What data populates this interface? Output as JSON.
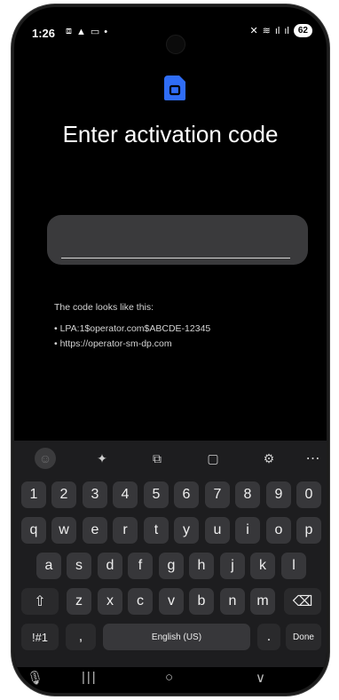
{
  "status_bar": {
    "time": "1:26",
    "left_icons": [
      "screenshot-icon",
      "warning-icon",
      "cast-icon",
      "dot-icon"
    ],
    "right_icons": [
      "mute-icon",
      "wifi-icon",
      "signal-icon",
      "signal-icon"
    ],
    "battery": "62"
  },
  "header": {
    "icon": "sim-card-icon",
    "title": "Enter activation code",
    "accent_color": "#2f6df6"
  },
  "code_input": {
    "value": "",
    "placeholder": ""
  },
  "hint": {
    "heading": "The code looks like this:",
    "examples": [
      "• LPA:1$operator.com$ABCDE-12345",
      "• https://operator-sm-dp.com"
    ]
  },
  "keyboard": {
    "toolbar": [
      "emoji-icon",
      "sparkle-icon",
      "translate-icon",
      "clipboard-icon",
      "settings-icon",
      "more-icon"
    ],
    "numbers": [
      "1",
      "2",
      "3",
      "4",
      "5",
      "6",
      "7",
      "8",
      "9",
      "0"
    ],
    "row1": [
      "q",
      "w",
      "e",
      "r",
      "t",
      "y",
      "u",
      "i",
      "o",
      "p"
    ],
    "row2": [
      "a",
      "s",
      "d",
      "f",
      "g",
      "h",
      "j",
      "k",
      "l"
    ],
    "row3": [
      "z",
      "x",
      "c",
      "v",
      "b",
      "n",
      "m"
    ],
    "shift_icon": "shift-icon",
    "backspace_icon": "backspace-icon",
    "symbols_label": "!#1",
    "comma_label": ",",
    "space_label": "English (US)",
    "period_label": ".",
    "done_label": "Done"
  },
  "nav_bar": [
    "mic-icon",
    "recents-icon",
    "home-icon",
    "back-icon"
  ]
}
